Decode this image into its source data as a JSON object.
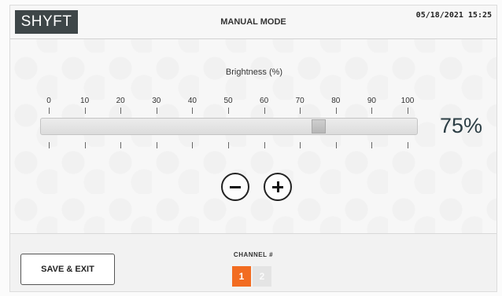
{
  "header": {
    "logo_text": "SHYFT",
    "mode_title": "MANUAL MODE",
    "datetime": "05/18/2021 15:25"
  },
  "slider": {
    "label": "Brightness (%)",
    "ticks": [
      "0",
      "10",
      "20",
      "30",
      "40",
      "50",
      "60",
      "70",
      "80",
      "90",
      "100"
    ],
    "value": 75,
    "value_display": "75%"
  },
  "controls": {
    "decrease_icon": "minus-icon",
    "increase_icon": "plus-icon"
  },
  "footer": {
    "save_label": "SAVE & EXIT",
    "channel_title": "CHANNEL #",
    "channels": [
      {
        "label": "1",
        "active": true
      },
      {
        "label": "2",
        "active": false
      }
    ]
  },
  "colors": {
    "logo_bg": "#3e4648",
    "accent": "#f26c21",
    "percent_text": "#2c3e45"
  }
}
